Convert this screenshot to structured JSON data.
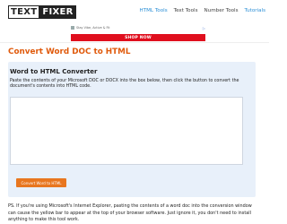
{
  "header": {
    "logo_part1": "TEXT",
    "logo_part2": "FIXER",
    "nav": [
      "HTML Tools",
      "Text Tools",
      "Number Tools",
      "Tutorials"
    ]
  },
  "ad": {
    "line": "Stay Vibe, Active & Fit",
    "button_label": "SHOP NOW"
  },
  "main": {
    "title": "Convert Word DOC to HTML",
    "panel_title": "Word to HTML Converter",
    "description": "Paste the contents of your Microsoft DOC or DOCX into the box below, then click the button to convert the document's contents into HTML code.",
    "textarea_value": "",
    "convert_label": "Convert Word to HTML",
    "ps_text": "PS. If you're using Microsoft's Internet Explorer, pasting the contents of a word doc into the conversion window can cause the yellow bar to appear at the top of your browser software. Just ignore it, you don't need to install anything to make this tool work."
  },
  "colors": {
    "accent_orange": "#e05a0c",
    "nav_blue": "#2b8fd6",
    "panel_bg": "#e8f0fa",
    "ad_red": "#e00f1e"
  }
}
